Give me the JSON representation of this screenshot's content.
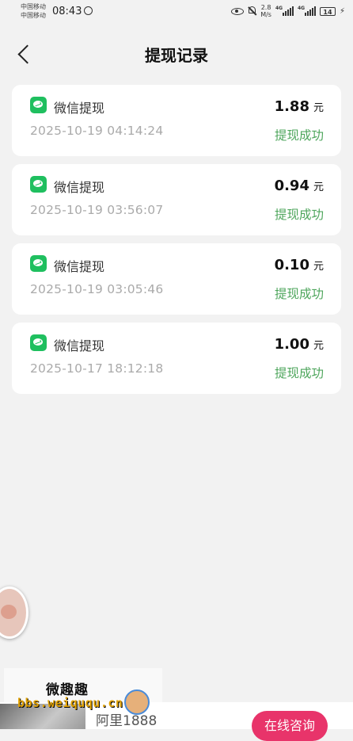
{
  "status_bar": {
    "carrier_line1": "中国移动",
    "carrier_line2": "中国移动",
    "time": "08:43",
    "net_speed_value": "2.8",
    "net_speed_unit": "M/s",
    "signal1_label": "4G",
    "signal2_label": "4G",
    "battery": "14"
  },
  "header": {
    "title": "提现记录"
  },
  "records": [
    {
      "name": "微信提现",
      "time": "2025-10-19 04:14:24",
      "amount": "1.88",
      "unit": "元",
      "status": "提现成功"
    },
    {
      "name": "微信提现",
      "time": "2025-10-19 03:56:07",
      "amount": "0.94",
      "unit": "元",
      "status": "提现成功"
    },
    {
      "name": "微信提现",
      "time": "2025-10-19 03:05:46",
      "amount": "0.10",
      "unit": "元",
      "status": "提现成功"
    },
    {
      "name": "微信提现",
      "time": "2025-10-17 18:12:18",
      "amount": "1.00",
      "unit": "元",
      "status": "提现成功"
    }
  ],
  "promo": {
    "watermark_top": "微趣趣",
    "watermark_bottom": "bbs.weiququ.cn",
    "shop_name": "阿里1888",
    "consult_label": "在线咨询"
  },
  "colors": {
    "success": "#4ea65c",
    "wechat": "#1fbf5f",
    "consult": "#e8346a"
  }
}
